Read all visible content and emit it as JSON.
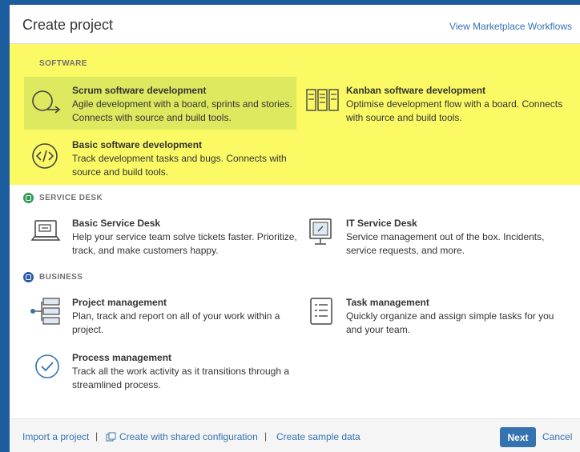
{
  "header": {
    "title": "Create project",
    "marketplace_link": "View Marketplace Workflows"
  },
  "sections": {
    "software": {
      "label": "SOFTWARE",
      "items": [
        {
          "name": "Scrum software development",
          "desc": "Agile development with a board, sprints and stories. Connects with source and build tools.",
          "icon": "scrum-cycle-icon",
          "selected": true
        },
        {
          "name": "Kanban software development",
          "desc": "Optimise development flow with a board. Connects with source and build tools.",
          "icon": "kanban-board-icon"
        },
        {
          "name": "Basic software development",
          "desc": "Track development tasks and bugs. Connects with source and build tools.",
          "icon": "code-brackets-icon"
        }
      ]
    },
    "service_desk": {
      "label": "SERVICE DESK",
      "items": [
        {
          "name": "Basic Service Desk",
          "desc": "Help your service team solve tickets faster. Prioritize, track, and make customers happy.",
          "icon": "laptop-icon"
        },
        {
          "name": "IT Service Desk",
          "desc": "Service management out of the box. Incidents, service requests, and more.",
          "icon": "monitor-icon"
        }
      ]
    },
    "business": {
      "label": "BUSINESS",
      "items": [
        {
          "name": "Project management",
          "desc": "Plan, track and report on all of your work within a project.",
          "icon": "project-hierarchy-icon"
        },
        {
          "name": "Task management",
          "desc": "Quickly organize and assign simple tasks for you and your team.",
          "icon": "task-list-icon"
        },
        {
          "name": "Process management",
          "desc": "Track all the work activity as it transitions through a streamlined process.",
          "icon": "process-check-icon"
        }
      ]
    }
  },
  "footer": {
    "import_link": "Import a project",
    "shared_config_link": "Create with shared configuration",
    "sample_data_link": "Create sample data",
    "separator": "|",
    "next_button": "Next",
    "cancel_link": "Cancel"
  },
  "colors": {
    "highlight": "#fbfa64",
    "selected": "#dde95f",
    "link": "#3572b0",
    "service_desk_badge": "#2f9a52",
    "business_badge": "#2a5aa6"
  }
}
